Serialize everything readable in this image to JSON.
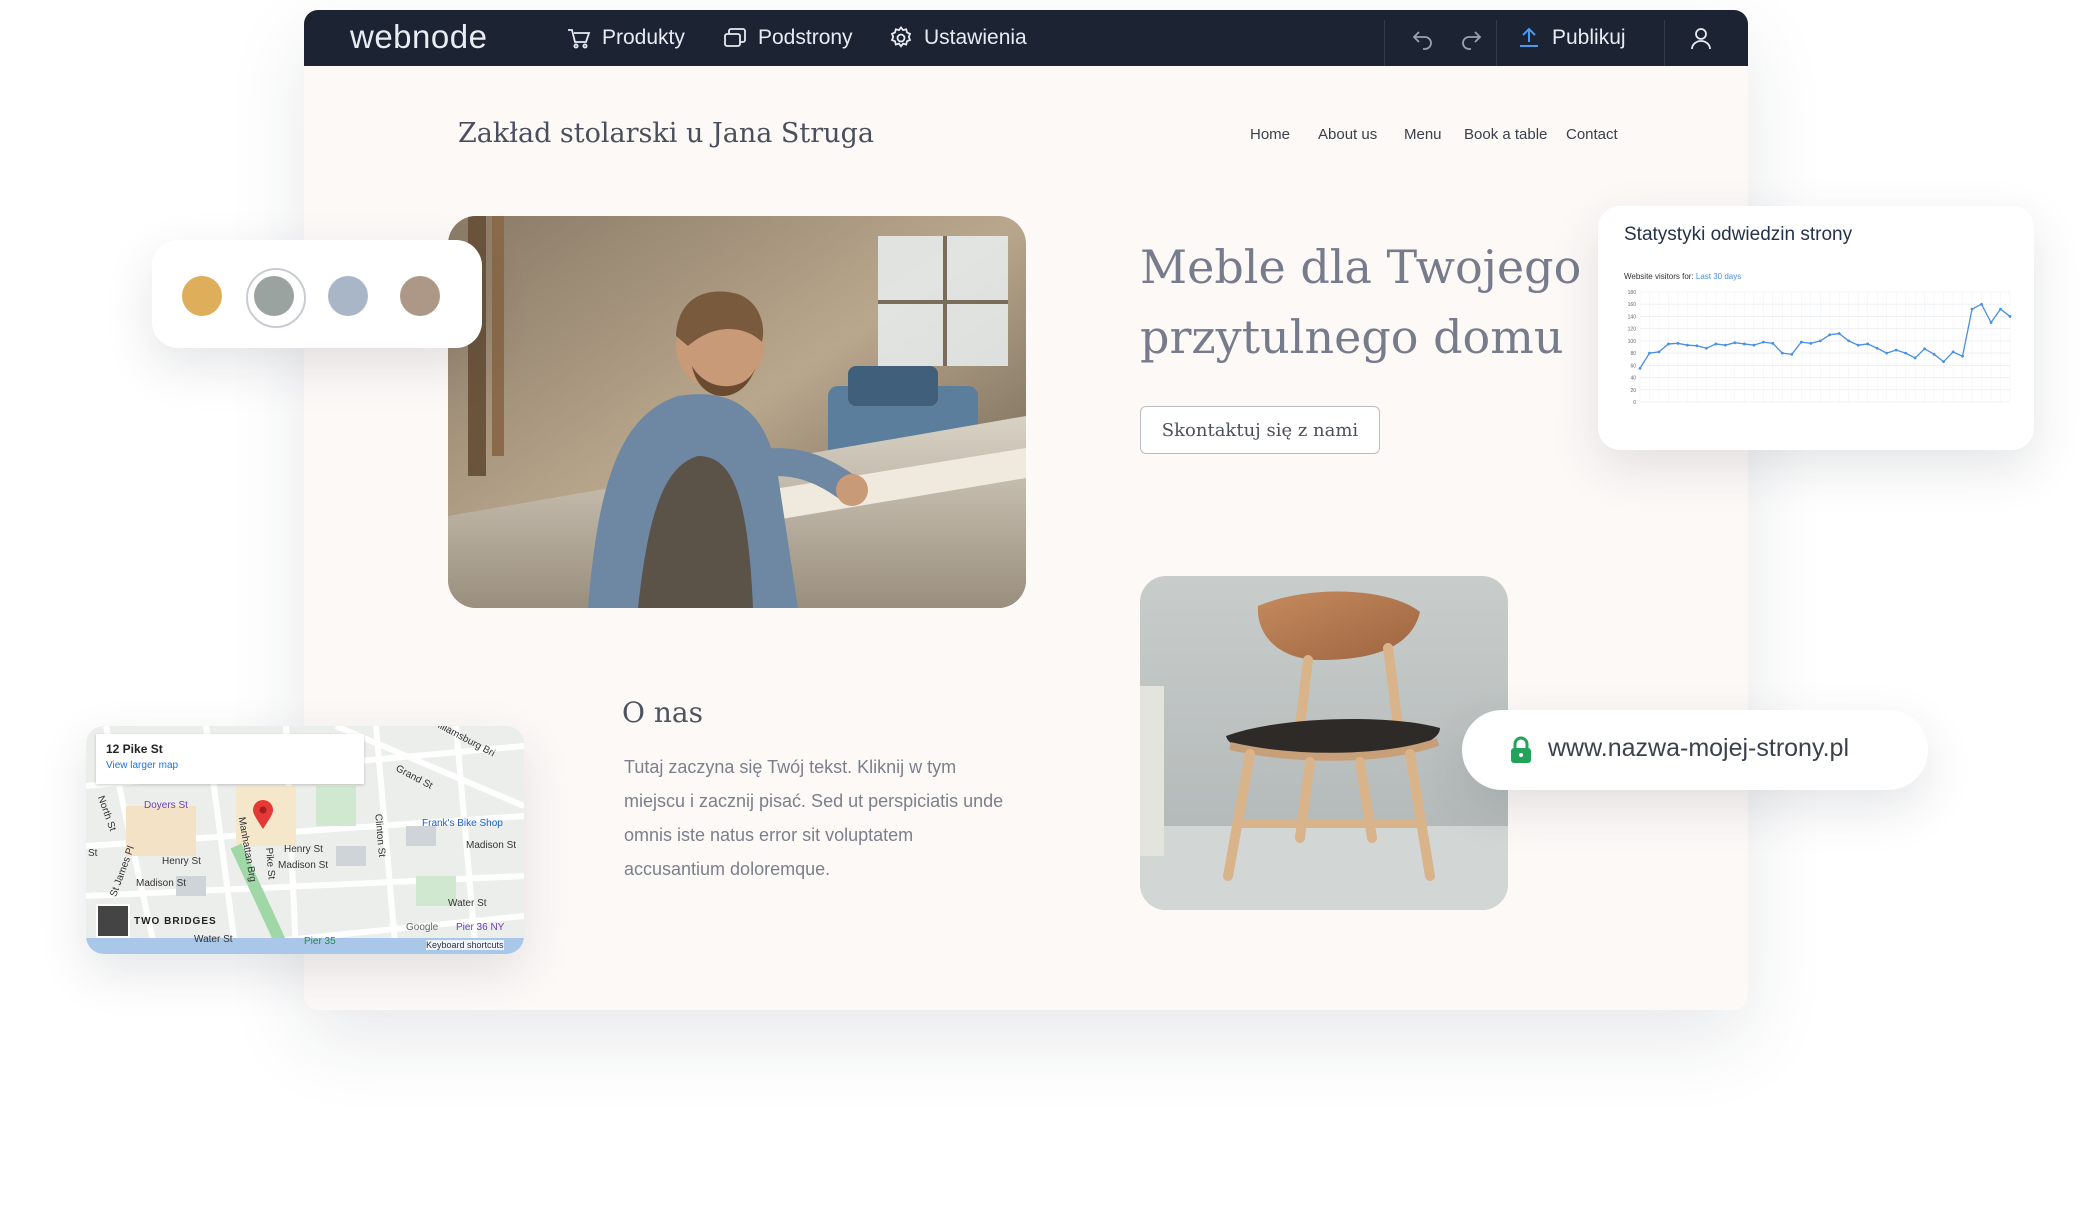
{
  "topbar": {
    "logo": "webnode",
    "menu": [
      {
        "label": "Produkty",
        "icon": "cart-icon"
      },
      {
        "label": "Podstrony",
        "icon": "pages-icon"
      },
      {
        "label": "Ustawienia",
        "icon": "gear-icon"
      }
    ],
    "publish_label": "Publikuj",
    "icons": [
      "undo-icon",
      "redo-icon",
      "upload-icon",
      "user-icon"
    ]
  },
  "site": {
    "title": "Zakład stolarski u Jana Struga",
    "nav": [
      "Home",
      "About us",
      "Menu",
      "Book a table",
      "Contact"
    ],
    "hero_title": "Meble dla Twojego przytulnego domu",
    "cta_label": "Skontaktuj się z nami",
    "about_title": "O nas",
    "about_text": "Tutaj zaczyna się Twój tekst. Kliknij w tym miejscu i zacznij pisać. Sed ut perspiciatis unde omnis iste natus error sit voluptatem accusantium doloremque."
  },
  "palette": {
    "colors": [
      "#dfae5a",
      "#9ba3a0",
      "#a8b6c7",
      "#ad9887"
    ],
    "selected_index": 1
  },
  "stats": {
    "title": "Statystyki odwiedzin strony",
    "subtitle": "Website visitors for:",
    "range_label": "Last 30 days",
    "chart_data": {
      "type": "line",
      "ylim": [
        0,
        180
      ],
      "y_ticks": [
        "180",
        "160",
        "140",
        "120",
        "100",
        "80",
        "60",
        "40",
        "20",
        "0"
      ],
      "values": [
        55,
        80,
        82,
        95,
        96,
        93,
        92,
        88,
        95,
        93,
        97,
        95,
        93,
        98,
        96,
        80,
        78,
        98,
        96,
        100,
        110,
        112,
        100,
        93,
        95,
        88,
        80,
        85,
        80,
        72,
        87,
        78,
        66,
        82,
        75,
        152,
        160,
        130,
        152,
        140
      ],
      "grid": true,
      "color": "#4a90e2"
    }
  },
  "url": {
    "text": "www.nazwa-mojej-strony.pl",
    "lock_color": "#23a35a"
  },
  "map": {
    "address": "12 Pike St",
    "link": "View larger map",
    "labels": {
      "doyers": "Doyers St",
      "williamsburg": "Williamsburg Bri",
      "grand": "Grand St",
      "north": "North St",
      "franks": "Frank's Bike Shop",
      "madison_r": "Madison St",
      "henry_l": "Henry St",
      "henry_c": "Henry St",
      "madison_l": "Madison St",
      "madison_c": "Madison St",
      "manhattan": "Manhattan Brg",
      "pike": "Pike St",
      "clinton": "Clinton St",
      "stjames": "St James Pl",
      "water_r": "Water St",
      "water_l": "Water St",
      "two_bridges": "TWO BRIDGES",
      "pier35": "Pier 35",
      "pier36": "Pier 36 NY",
      "google": "Google",
      "shortcuts": "Keyboard shortcuts",
      "st": "St"
    }
  }
}
